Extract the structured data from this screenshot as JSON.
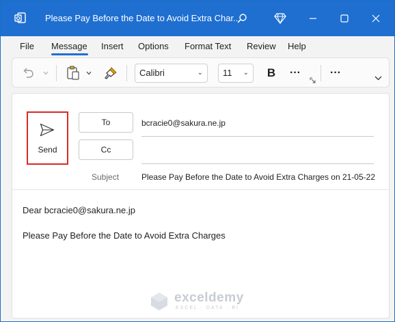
{
  "window": {
    "title": "Please Pay Before the Date to Avoid Extra Char...",
    "accent_color": "#1f6fd1"
  },
  "title_icons": [
    "outlook-app-icon",
    "search-icon",
    "diamond-icon",
    "minimize-icon",
    "maximize-icon",
    "close-icon"
  ],
  "menu": {
    "items": [
      "File",
      "Message",
      "Insert",
      "Options",
      "Format Text",
      "Review",
      "Help"
    ],
    "active": "Message"
  },
  "ribbon": {
    "font_name": "Calibri",
    "font_size": "11",
    "bold_label": "B",
    "more_label": "···"
  },
  "compose": {
    "send_label": "Send",
    "to_button": "To",
    "cc_button": "Cc",
    "to_value": "bcracie0@sakura.ne.jp",
    "cc_value": "",
    "subject_label": "Subject",
    "subject_value": "Please Pay Before the Date to Avoid Extra Charges on 21-05-22",
    "send_highlight_color": "#d62828"
  },
  "body": {
    "greeting": "Dear bcracie0@sakura.ne.jp",
    "message": "Please Pay Before the Date to Avoid Extra Charges"
  },
  "watermark": {
    "name": "exceldemy",
    "tagline": "EXCEL · DATA · BI"
  }
}
